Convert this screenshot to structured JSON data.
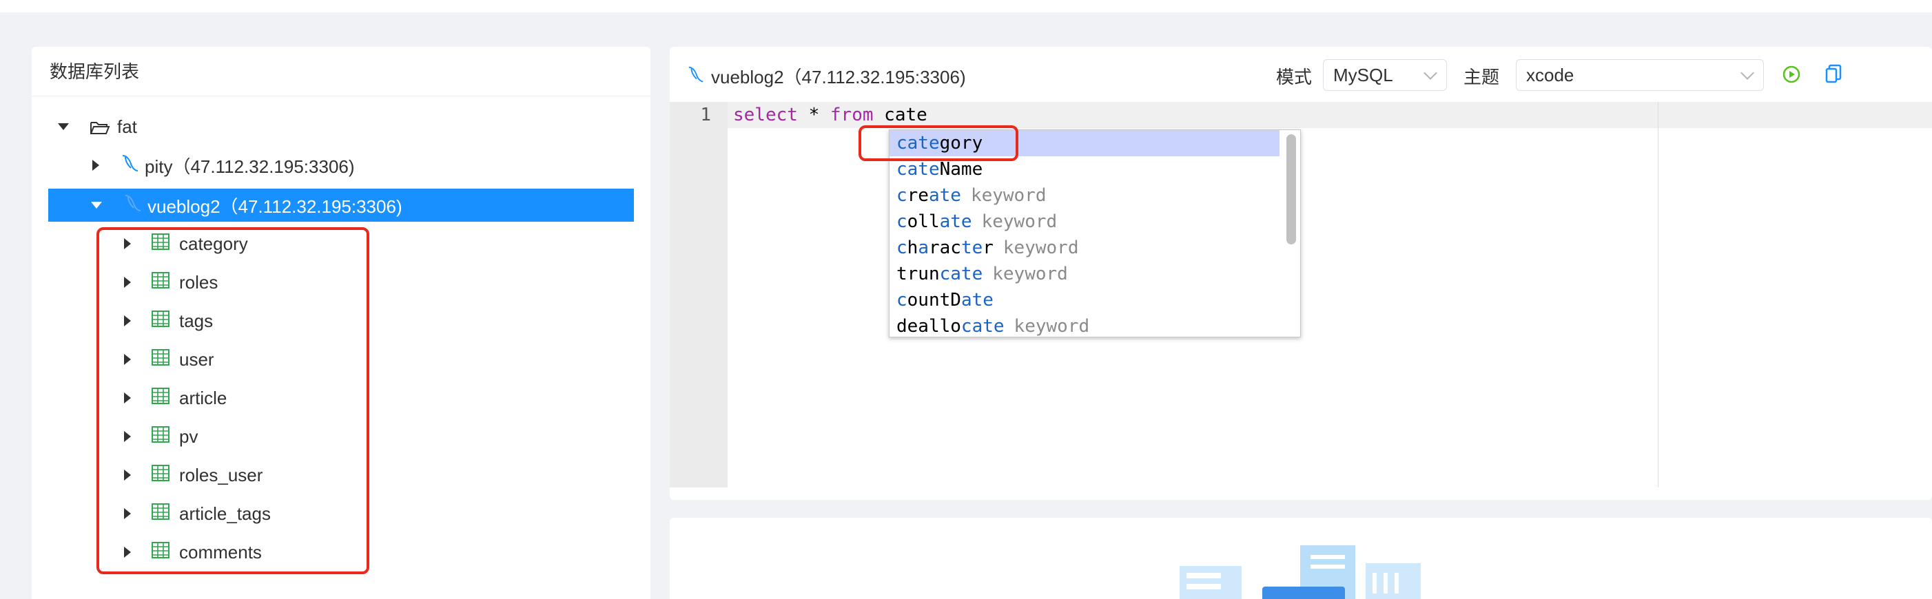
{
  "left_panel": {
    "title": "数据库列表",
    "root": {
      "label": "fat"
    },
    "connections": [
      {
        "label": "pity（47.112.32.195:3306)",
        "expanded": false
      },
      {
        "label": "vueblog2（47.112.32.195:3306)",
        "expanded": true
      }
    ],
    "tables": [
      "category",
      "roles",
      "tags",
      "user",
      "article",
      "pv",
      "roles_user",
      "article_tags",
      "comments"
    ]
  },
  "editor": {
    "connection_label": "vueblog2（47.112.32.195:3306)",
    "mode_label": "模式",
    "mode_value": "MySQL",
    "theme_label": "主题",
    "theme_value": "xcode",
    "line_number": "1",
    "code": {
      "kw1": "select",
      "mid": " * ",
      "kw2": "from",
      "rest": " cate"
    }
  },
  "autocomplete": [
    {
      "match": "cate",
      "rest": "gory",
      "meta": ""
    },
    {
      "match": "cate",
      "rest": "Name",
      "meta": ""
    },
    {
      "pre": "",
      "text_html": "create",
      "meta": "keyword"
    },
    {
      "text_html": "collate",
      "meta": "keyword"
    },
    {
      "text_html": "character",
      "meta": "keyword"
    },
    {
      "text_html": "truncate",
      "meta": "keyword"
    },
    {
      "text_html": "countDate",
      "meta": ""
    },
    {
      "text_html": "deallocate",
      "meta": "keyword"
    }
  ],
  "colors": {
    "accent": "#1890ff",
    "highlight": "#e8291b",
    "run_icon": "#52c41a",
    "copy_icon": "#1890ff"
  }
}
